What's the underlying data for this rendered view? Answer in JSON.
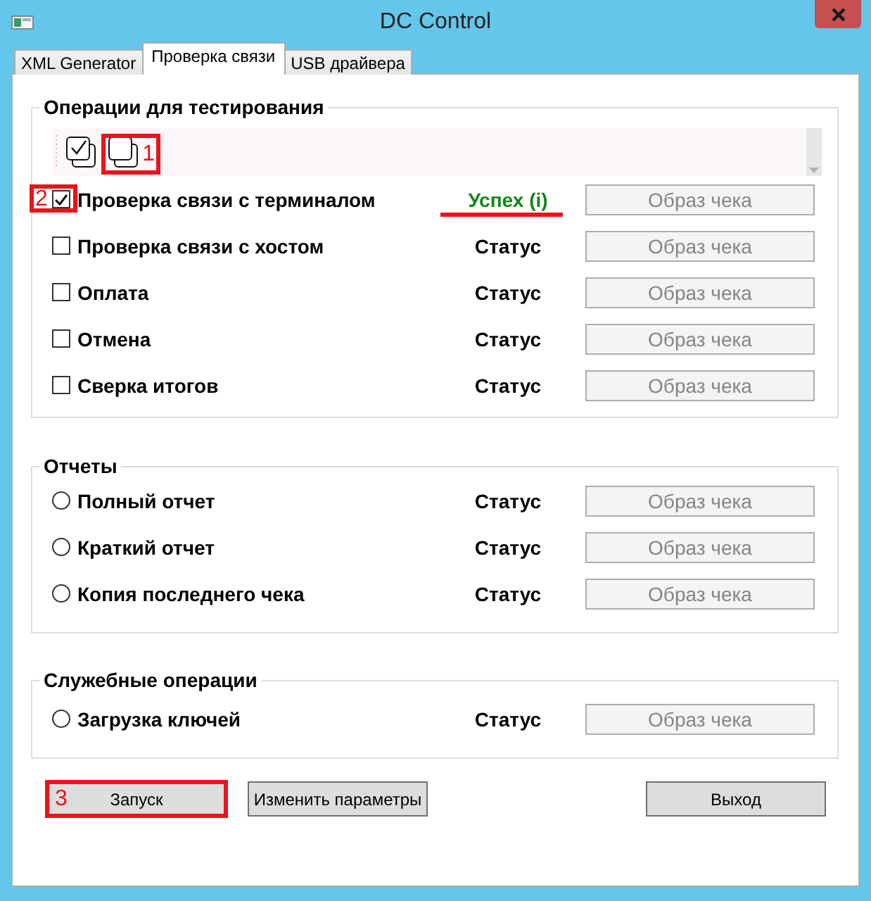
{
  "window": {
    "title": "DC Control"
  },
  "tabs": [
    {
      "label": "XML Generator",
      "selected": false
    },
    {
      "label": "Проверка связи",
      "selected": true
    },
    {
      "label": "USB драйвера",
      "selected": false
    }
  ],
  "groups": [
    {
      "title": "Операции для тестирования",
      "toolbar": {
        "tools": [
          {
            "kind": "check"
          },
          {
            "kind": "clear",
            "callout": "1"
          }
        ]
      },
      "items": [
        {
          "kind": "checkbox",
          "label": "Проверка связи с терминалом",
          "checked": true,
          "callout": "2",
          "status": {
            "text": "Успех (i)",
            "kind": "success",
            "underlined": true
          },
          "button": {
            "label": "Образ чека",
            "disabled": true
          }
        },
        {
          "kind": "checkbox",
          "label": "Проверка связи с хостом",
          "checked": false,
          "status": {
            "text": "Статус",
            "kind": "neutral",
            "underlined": false
          },
          "button": {
            "label": "Образ чека",
            "disabled": true
          }
        },
        {
          "kind": "checkbox",
          "label": "Оплата",
          "checked": false,
          "status": {
            "text": "Статус",
            "kind": "neutral",
            "underlined": false
          },
          "button": {
            "label": "Образ чека",
            "disabled": true
          }
        },
        {
          "kind": "checkbox",
          "label": "Отмена",
          "checked": false,
          "status": {
            "text": "Статус",
            "kind": "neutral",
            "underlined": false
          },
          "button": {
            "label": "Образ чека",
            "disabled": true
          }
        },
        {
          "kind": "checkbox",
          "label": "Сверка итогов",
          "checked": false,
          "status": {
            "text": "Статус",
            "kind": "neutral",
            "underlined": false
          },
          "button": {
            "label": "Образ чека",
            "disabled": true
          }
        }
      ]
    },
    {
      "title": "Отчеты",
      "items": [
        {
          "kind": "radio",
          "label": "Полный отчет",
          "selected": false,
          "status": {
            "text": "Статус",
            "kind": "neutral",
            "underlined": false
          },
          "button": {
            "label": "Образ чека",
            "disabled": true
          }
        },
        {
          "kind": "radio",
          "label": "Краткий отчет",
          "selected": false,
          "status": {
            "text": "Статус",
            "kind": "neutral",
            "underlined": false
          },
          "button": {
            "label": "Образ чека",
            "disabled": true
          }
        },
        {
          "kind": "radio",
          "label": "Копия последнего чека",
          "selected": false,
          "status": {
            "text": "Статус",
            "kind": "neutral",
            "underlined": false
          },
          "button": {
            "label": "Образ чека",
            "disabled": true
          }
        }
      ]
    },
    {
      "title": "Служебные операции",
      "items": [
        {
          "kind": "radio",
          "label": "Загрузка ключей",
          "selected": false,
          "status": {
            "text": "Статус",
            "kind": "neutral",
            "underlined": false
          },
          "button": {
            "label": "Образ чека",
            "disabled": true
          }
        }
      ]
    }
  ],
  "buttons": [
    {
      "label": "Запуск",
      "callout": "3"
    },
    {
      "label": "Изменить параметры"
    },
    {
      "label": "Выход"
    }
  ]
}
